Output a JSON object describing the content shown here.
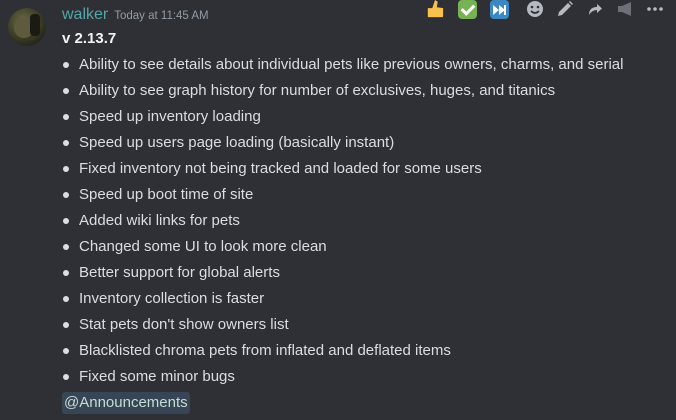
{
  "message": {
    "username": "walker",
    "timestamp": "Today at 11:45 AM",
    "version": "v 2.13.7",
    "changes": [
      "Ability to see details about individual pets like previous owners, charms, and serial",
      "Ability to see graph history for number of exclusives, huges, and titanics",
      "Speed up inventory loading",
      "Speed up users page loading (basically instant)",
      "Fixed inventory not being tracked and loaded for some users",
      "Speed up boot time of site",
      "Added wiki links for pets",
      "Changed some UI to look more clean",
      "Better support for global alerts",
      "Inventory collection is faster",
      "Stat pets don't show owners list",
      "Blacklisted chroma pets from inflated and deflated items",
      "Fixed some minor bugs"
    ],
    "mention": "@Announcements"
  },
  "toolbar": {
    "reactions": [
      "thumbs-up-icon",
      "check-mark-icon",
      "next-track-icon"
    ],
    "actions": [
      "add-reaction-icon",
      "edit-icon",
      "reply-icon",
      "announce-icon",
      "more-icon"
    ]
  },
  "colors": {
    "background": "#2e3035",
    "username": "#52a7a8",
    "text": "#dbdee1",
    "timestamp": "#949ba4",
    "mention_bg": "#374554"
  }
}
